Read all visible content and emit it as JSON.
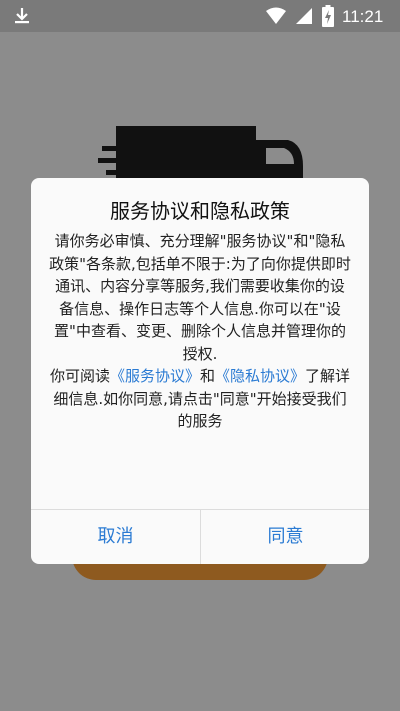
{
  "status_bar": {
    "time": "11:21",
    "icons": [
      "download-icon",
      "wifi-icon",
      "signal-icon",
      "battery-charging-icon"
    ]
  },
  "dialog": {
    "title": "服务协议和隐私政策",
    "paragraph1": "请你务必审慎、充分理解\"服务协议\"和\"隐私政策\"各条款,包括单不限于:为了向你提供即时通讯、内容分享等服务,我们需要收集你的设备信息、操作日志等个人信息.你可以在\"设置\"中查看、变更、删除个人信息并管理你的授权.",
    "p2_prefix": "你可阅读",
    "link_service": "《服务协议》",
    "p2_and": "和",
    "link_privacy": "《隐私协议》",
    "p2_suffix": "了解详细信息.如你同意,请点击\"同意\"开始接受我们的服务",
    "cancel_label": "取消",
    "agree_label": "同意"
  },
  "colors": {
    "link": "#2b7bd3",
    "overlay_bg": "#8c8c8c",
    "accent_button": "#8e5a1f"
  }
}
